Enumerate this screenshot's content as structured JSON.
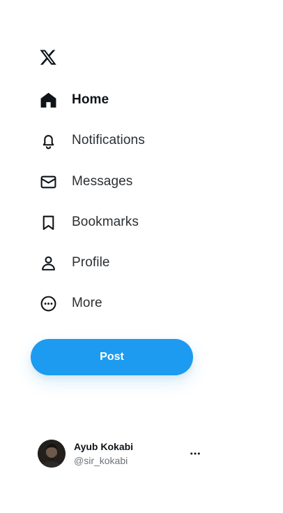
{
  "brand": {
    "logo_icon": "x-logo-icon"
  },
  "nav": {
    "items": [
      {
        "label": "Home",
        "icon": "home-icon",
        "active": true
      },
      {
        "label": "Notifications",
        "icon": "bell-icon",
        "active": false
      },
      {
        "label": "Messages",
        "icon": "envelope-icon",
        "active": false
      },
      {
        "label": "Bookmarks",
        "icon": "bookmark-icon",
        "active": false
      },
      {
        "label": "Profile",
        "icon": "person-icon",
        "active": false
      },
      {
        "label": "More",
        "icon": "more-circle-icon",
        "active": false
      }
    ]
  },
  "post_button": {
    "label": "Post",
    "color": "#1d9bf0"
  },
  "account": {
    "name": "Ayub Kokabi",
    "handle": "@sir_kokabi",
    "menu_icon": "ellipsis-icon"
  }
}
